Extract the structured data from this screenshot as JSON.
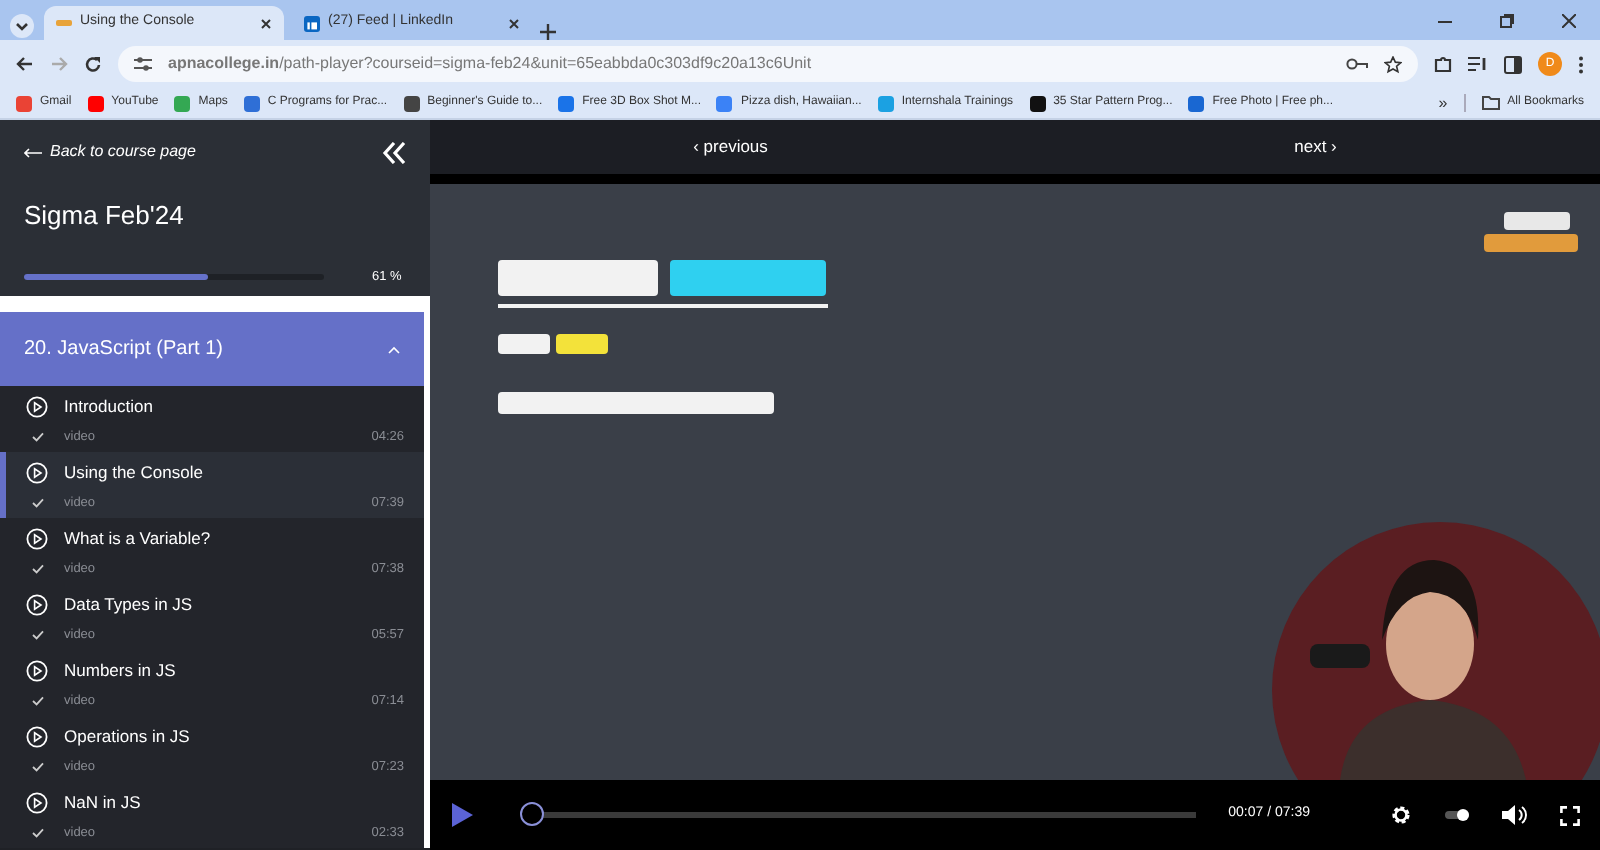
{
  "browser": {
    "tabs": [
      {
        "title": "Using the Console",
        "selected": true
      },
      {
        "title": "(27) Feed | LinkedIn",
        "selected": false
      }
    ],
    "url": "**apnacollege.in**/path-player?courseid=sigma-feb24&unit=65eabbda0c303df9c20a13c6Unit",
    "profile_initial": "D",
    "bookmarks": [
      {
        "label": "Gmail",
        "color": "#ea4335"
      },
      {
        "label": "YouTube",
        "color": "#ff0000"
      },
      {
        "label": "Maps",
        "color": "#34a853"
      },
      {
        "label": "C Programs for Prac...",
        "color": "#2f6fd6"
      },
      {
        "label": "Beginner's Guide to...",
        "color": "#444444"
      },
      {
        "label": "Free 3D Box Shot M...",
        "color": "#1a73e8"
      },
      {
        "label": "Pizza dish, Hawaiian...",
        "color": "#3b82f6"
      },
      {
        "label": "Internshala Trainings",
        "color": "#1ba1e2"
      },
      {
        "label": "35 Star Pattern Prog...",
        "color": "#111111"
      },
      {
        "label": "Free Photo | Free ph...",
        "color": "#1967d2"
      }
    ],
    "overflow": "»",
    "all_bookmarks": "All Bookmarks"
  },
  "sidebar": {
    "back_link": "Back to course page",
    "course_title": "Sigma Feb'24",
    "progress": {
      "level": 0.61,
      "reading": "61 %"
    },
    "section": {
      "title": "20. JavaScript (Part 1)",
      "expanded": true
    },
    "lessons": [
      {
        "title": "Introduction",
        "type": "video",
        "duration": "04:26",
        "completed": true,
        "selected": false
      },
      {
        "title": "Using the Console",
        "type": "video",
        "duration": "07:39",
        "completed": true,
        "selected": true
      },
      {
        "title": "What is a Variable?",
        "type": "video",
        "duration": "07:38",
        "completed": true,
        "selected": false
      },
      {
        "title": "Data Types in JS",
        "type": "video",
        "duration": "05:57",
        "completed": true,
        "selected": false
      },
      {
        "title": "Numbers in JS",
        "type": "video",
        "duration": "07:14",
        "completed": true,
        "selected": false
      },
      {
        "title": "Operations in JS",
        "type": "video",
        "duration": "07:23",
        "completed": true,
        "selected": false
      },
      {
        "title": "NaN in JS",
        "type": "video",
        "duration": "02:33",
        "completed": true,
        "selected": false
      }
    ]
  },
  "player": {
    "previous": "‹ previous",
    "next": "next ›",
    "controls": {
      "playing": false,
      "level": 0.016,
      "time": "00:07 / 07:39"
    }
  }
}
